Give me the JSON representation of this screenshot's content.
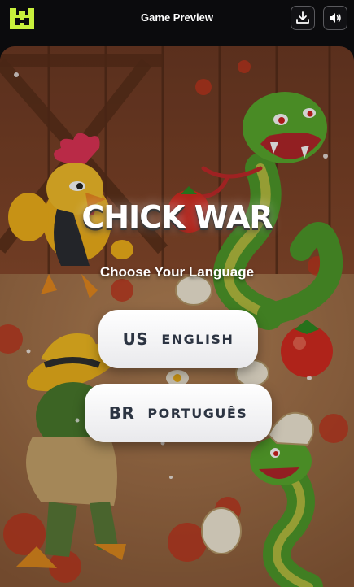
{
  "header": {
    "title": "Game Preview",
    "logo_icon": "game-logo-icon",
    "download_icon": "download-icon",
    "sound_icon": "speaker-icon"
  },
  "game": {
    "title": "CHICK WAR",
    "subtitle": "Choose Your Language"
  },
  "languages": [
    {
      "code": "US",
      "label": "ENGLISH"
    },
    {
      "code": "BR",
      "label": "PORTUGUÊS"
    }
  ],
  "colors": {
    "logo": "#c8f03c",
    "button_text": "#2c3442",
    "background": "#0b0b0d"
  }
}
